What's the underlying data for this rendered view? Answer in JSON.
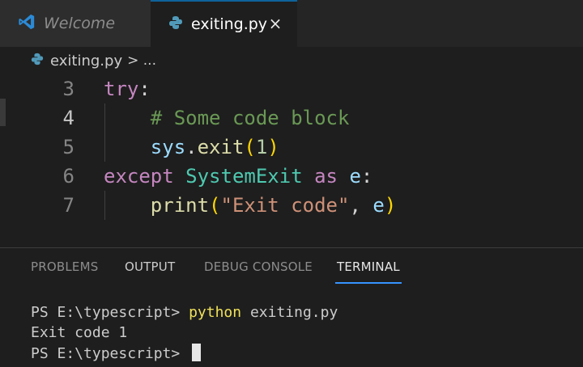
{
  "tabs": [
    {
      "label": "Welcome",
      "icon": "vscode-logo-icon",
      "active": false
    },
    {
      "label": "exiting.py",
      "icon": "python-file-icon",
      "active": true,
      "close": "×"
    }
  ],
  "breadcrumb": {
    "file": "exiting.py",
    "separator": "> ..."
  },
  "editor": {
    "lines": [
      {
        "number": "3"
      },
      {
        "number": "4"
      },
      {
        "number": "5"
      },
      {
        "number": "6"
      },
      {
        "number": "7"
      }
    ],
    "tokens": {
      "try": "try",
      "colon": ":",
      "comment": "# Some code block",
      "sys": "sys",
      "dot": ".",
      "exit": "exit",
      "lparen": "(",
      "one": "1",
      "rparen": ")",
      "except": "except",
      "systemexit": "SystemExit",
      "as": "as",
      "e": "e",
      "print": "print",
      "str_exit": "\"Exit code\"",
      "comma": ", "
    }
  },
  "panel": {
    "tabs": [
      "PROBLEMS",
      "OUTPUT",
      "DEBUG CONSOLE",
      "TERMINAL"
    ],
    "active_tab": "TERMINAL",
    "terminal": {
      "prompt1": "PS E:\\typescript> ",
      "cmd_name": "python",
      "cmd_args": " exiting.py",
      "output": "Exit code 1",
      "prompt2": "PS E:\\typescript> "
    }
  },
  "colors": {
    "accent": "#3794ff",
    "keyword_control": "#c586c0",
    "comment": "#6a9955",
    "function": "#dcdcaa",
    "class": "#4ec9b0"
  }
}
